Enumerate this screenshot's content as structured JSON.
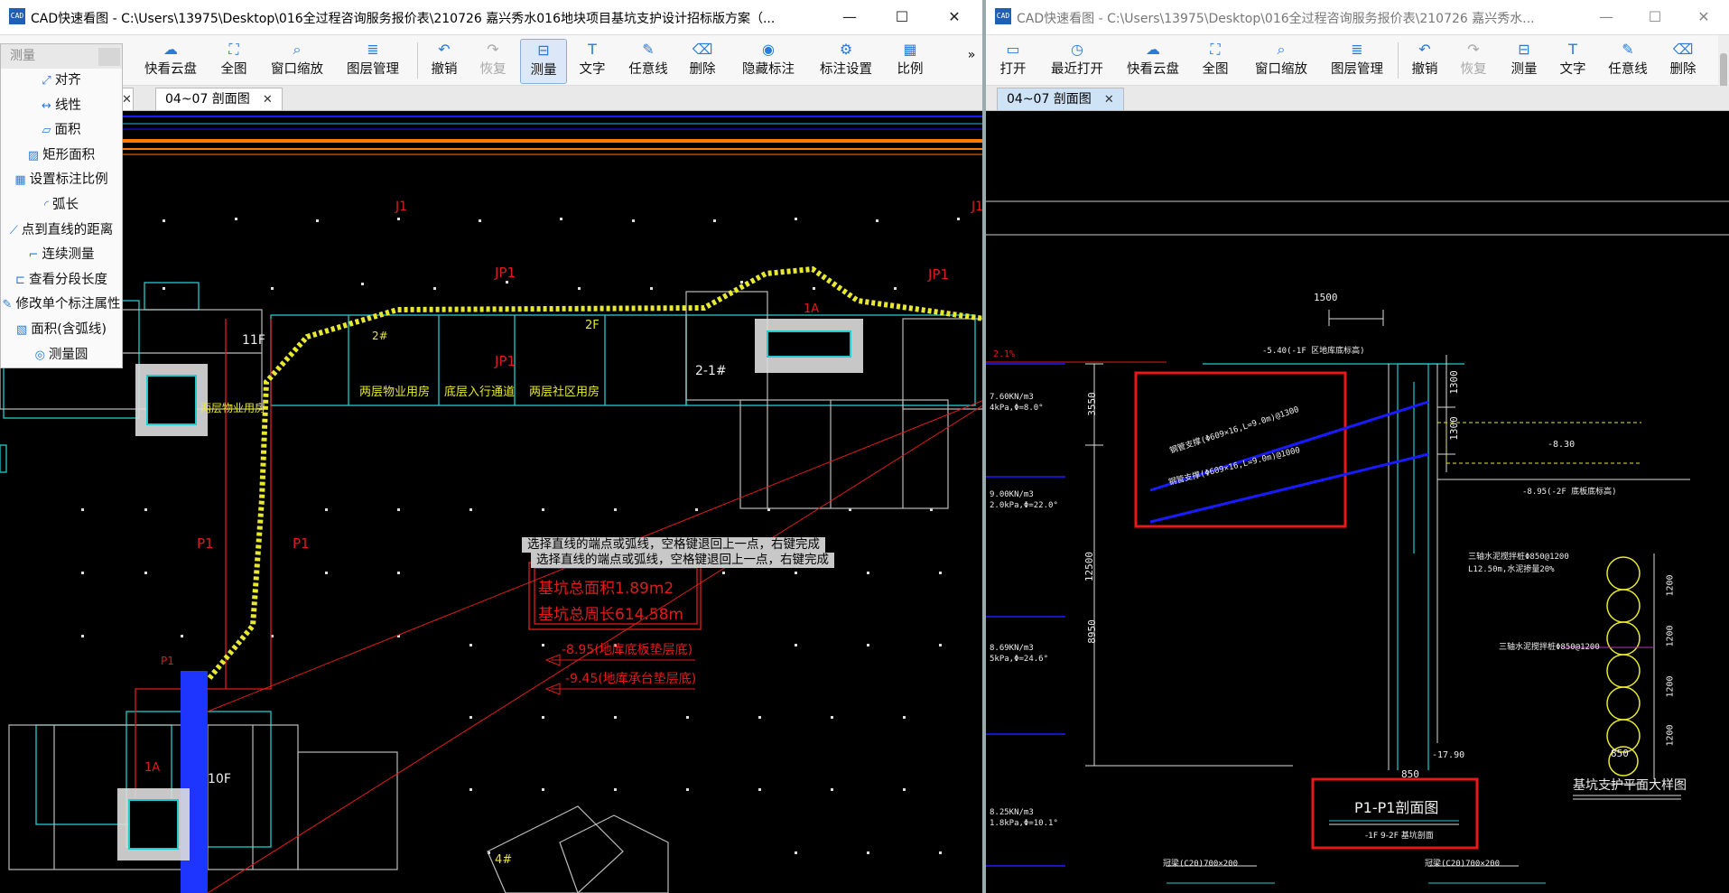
{
  "left": {
    "title": "CAD快速看图 - C:\\Users\\13975\\Desktop\\016全过程咨询服务报价表\\210726 嘉兴秀水016地块项目基坑支护设计招标版方案（...",
    "toolbar": [
      "快看云盘",
      "全图",
      "窗口缩放",
      "图层管理",
      "撤销",
      "恢复",
      "测量",
      "文字",
      "任意线",
      "删除",
      "隐藏标注",
      "标注设置",
      "比例"
    ],
    "more": "»",
    "tabs": [
      "04~07 剖面图"
    ],
    "measure_menu": {
      "header": "测量",
      "items": [
        "对齐",
        "线性",
        "面积",
        "矩形面积",
        "设置标注比例",
        "弧长",
        "点到直线的距离",
        "连续测量",
        "查看分段长度",
        "修改单个标注属性",
        "面积(含弧线)",
        "测量圆"
      ]
    },
    "prompts": [
      "选择直线的端点或弧线，空格键退回上一点，右键完成",
      "选择直线的端点或弧线，空格键退回上一点，右键完成"
    ],
    "result_area": "基坑总面积1.89m2",
    "result_perim": "基坑总周长614.58m",
    "annot1": "-8.95(地库底板垫层底)",
    "annot2": "-9.45(地库承台垫层底)",
    "labels": [
      "J1",
      "J1",
      "JP1",
      "JP1",
      "JP1",
      "P1",
      "P1",
      "P1",
      "11F",
      "10F",
      "1A",
      "1A",
      "2F",
      "2-1#",
      "两层物业用房",
      "底层入行通道",
      "两层社区用房",
      "两层物业用房",
      "2#",
      "4#"
    ]
  },
  "right": {
    "title": "CAD快速看图 - C:\\Users\\13975\\Desktop\\016全过程咨询服务报价表\\210726 嘉兴秀水...",
    "toolbar": [
      "打开",
      "最近打开",
      "快看云盘",
      "全图",
      "窗口缩放",
      "图层管理",
      "撤销",
      "恢复",
      "测量",
      "文字",
      "任意线",
      "删除"
    ],
    "tabs": [
      "04~07 剖面图"
    ],
    "section_title": "P1-P1剖面图",
    "section_sub": "-1F 9-2F 基坑剖面",
    "plan_title": "基坑支护平面大样图",
    "dims": [
      "1500",
      "1300",
      "1300",
      "3550",
      "12500",
      "8950",
      "850",
      "850",
      "1200",
      "1200",
      "1200",
      "1200",
      "-17.90",
      "-8.30",
      "-8.95(-2F 底板底标高)",
      "-5.40(-1F 区地库底标高)",
      "2.1%"
    ],
    "soil": [
      "7.60KN/m3",
      "4kPa,Φ=8.0°",
      "9.00KN/m3",
      "2.0kPa,Φ=22.0°",
      "8.69KN/m3",
      "5kPa,Φ=24.6°",
      "8.25KN/m3",
      "1.8kPa,Φ=10.1°"
    ],
    "notes": [
      "钢管支撑(Φ609×16,L=9.0m)@1300",
      "钢管支撑(Φ609×16,L=9.0m)@1000",
      "三轴水泥搅拌桩Φ850@1200",
      "L12.50m,水泥掺量20%",
      "三轴水泥搅拌桩Φ850@1200",
      "冠梁(C20)700×200",
      "冠梁(C20)700×200"
    ]
  },
  "window_controls": [
    "—",
    "☐",
    "✕"
  ]
}
